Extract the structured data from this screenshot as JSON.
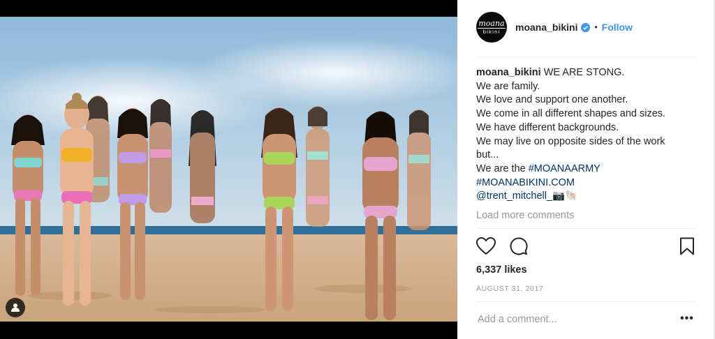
{
  "post": {
    "username": "moana_bikini",
    "follow_label": "Follow",
    "dot": "•",
    "avatar": {
      "line1": "moana",
      "line2": "bikini"
    },
    "caption_lines": [
      "WE ARE STONG.",
      "We are family.",
      "We love and support one another.",
      "We come in all different shapes and sizes.",
      "We have different backgrounds.",
      "We may live on opposite sides of the work",
      "but...",
      "We are the ",
      "#MOANAARMY",
      "#MOANABIKINI.COM",
      "@trent_mitchell_",
      "📷🐚"
    ],
    "load_more": "Load more comments",
    "likes": "6,337 likes",
    "date": "AUGUST 31, 2017",
    "comment_placeholder": "Add a comment...",
    "more_label": "•••"
  },
  "icons": {
    "verified": "verified-badge-icon",
    "like": "heart-icon",
    "comment": "comment-bubble-icon",
    "save": "bookmark-icon",
    "user_tag": "person-tag-icon"
  },
  "colors": {
    "link": "#003569",
    "follow": "#3897f0",
    "muted": "#999999",
    "text": "#262626"
  }
}
